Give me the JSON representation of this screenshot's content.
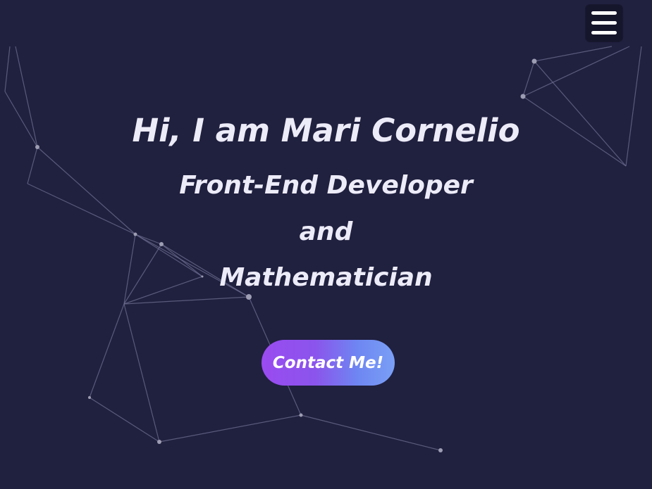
{
  "menu": {
    "icon": "hamburger-menu-icon"
  },
  "hero": {
    "greeting": "Hi, I am Mari Cornelio",
    "role_line_1": "Front-End Developer",
    "role_line_2": "and",
    "role_line_3": "Mathematician"
  },
  "cta": {
    "label": "Contact Me!"
  },
  "colors": {
    "background": "#20203f",
    "text": "#ecebf8",
    "cta_gradient_start": "#9a4bf1",
    "cta_gradient_end": "#7aa0f6",
    "network_lines": "#7a7a9e",
    "network_nodes": "#9a9ab0"
  }
}
